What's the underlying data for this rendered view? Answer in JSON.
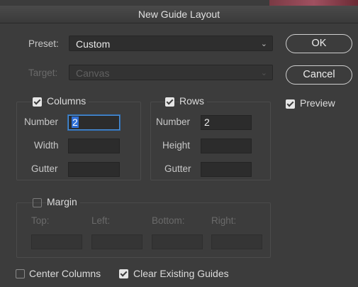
{
  "dialog": {
    "title": "New Guide Layout"
  },
  "preset": {
    "label": "Preset:",
    "value": "Custom"
  },
  "target": {
    "label": "Target:",
    "value": "Canvas"
  },
  "buttons": {
    "ok": "OK",
    "cancel": "Cancel"
  },
  "preview": {
    "label": "Preview",
    "checked": true
  },
  "columns": {
    "label": "Columns",
    "checked": true,
    "number_label": "Number",
    "number_value": "2",
    "width_label": "Width",
    "width_value": "",
    "gutter_label": "Gutter",
    "gutter_value": ""
  },
  "rows": {
    "label": "Rows",
    "checked": true,
    "number_label": "Number",
    "number_value": "2",
    "height_label": "Height",
    "height_value": "",
    "gutter_label": "Gutter",
    "gutter_value": ""
  },
  "margin": {
    "label": "Margin",
    "checked": false,
    "top_label": "Top:",
    "left_label": "Left:",
    "bottom_label": "Bottom:",
    "right_label": "Right:"
  },
  "footer": {
    "center_columns": {
      "label": "Center Columns",
      "checked": false
    },
    "clear_guides": {
      "label": "Clear Existing Guides",
      "checked": true
    }
  },
  "colors": {
    "background": "#3c3c3c",
    "focus_ring": "#4a8fd8",
    "selection": "#2f6fd6"
  }
}
